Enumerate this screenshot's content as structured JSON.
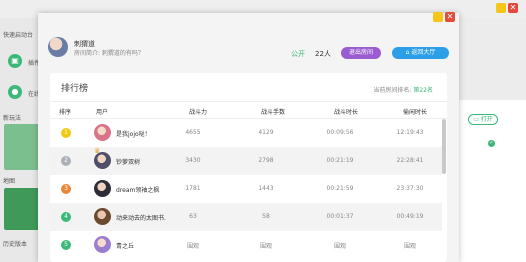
{
  "background_app": {
    "left_panel": {
      "quick_start": "快速启动台",
      "plugin_label": "插件",
      "online_label": "在线",
      "new_play": "新玩法",
      "map_label": "地图",
      "history_label": "历史版本"
    },
    "right_panel": {
      "open_label": "打开"
    }
  },
  "room": {
    "name": "刺猬道",
    "intro": "房间简介: 刺猬道的有吗？",
    "public_label": "公开",
    "people_count": "22人",
    "exit_button": "退出房间",
    "lobby_button": "返回大厅"
  },
  "leaderboard": {
    "title": "排行榜",
    "room_rank_prefix": "当前房间排名: ",
    "room_rank_value": "第22名",
    "columns": [
      "排序",
      "用户",
      "战斗力",
      "战斗手数",
      "战斗时长",
      "偷闲时长"
    ],
    "rows": [
      {
        "rank": "1",
        "user": "是我jojo哒！",
        "power": "4655",
        "battles": "4129",
        "battle_time": "00:09:56",
        "idle_time": "12:19:43"
      },
      {
        "rank": "2",
        "user": "钞萝双树",
        "power": "3430",
        "battles": "2798",
        "battle_time": "00:21:19",
        "idle_time": "22:28:41"
      },
      {
        "rank": "3",
        "user": "dream领袖之枫",
        "power": "1781",
        "battles": "1443",
        "battle_time": "00:21:59",
        "idle_time": "23:37:30"
      },
      {
        "rank": "4",
        "user": "动来动去的太图书.",
        "power": "63",
        "battles": "58",
        "battle_time": "00:01:37",
        "idle_time": "00:49:19"
      },
      {
        "rank": "5",
        "user": "青之丘",
        "power": "围观",
        "battles": "围观",
        "battle_time": "围观",
        "idle_time": "围观"
      }
    ]
  },
  "colors": {
    "green": "#3cb878",
    "purple": "#9b5cd1",
    "blue": "#2d9ee8",
    "rank1": "#f2c811",
    "rank2": "#aab0b8",
    "rank3": "#e8873a",
    "rank4": "#3cb878",
    "rank5": "#3cb878"
  }
}
